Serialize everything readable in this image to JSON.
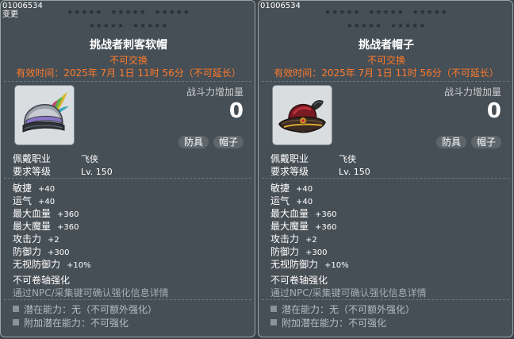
{
  "panels": [
    {
      "code": "01006534",
      "change_label": "变更",
      "stars_row1": [
        "★★★★★",
        "★★★★★",
        "★★★★★"
      ],
      "stars_row2": [
        "★★★★★",
        "★★★★★"
      ],
      "title": "挑战者刺客软帽",
      "untradeable": "不可交换",
      "expiry": "有效时间：2025年 7月 1日 11时 56分（不可延长）",
      "icon": "assassin-hat-icon",
      "power_label": "战斗力增加量",
      "power_value": "0",
      "tags": [
        "防具",
        "帽子"
      ],
      "job_label": "佩戴职业",
      "job_value": "飞侠",
      "level_label": "要求等级",
      "level_value": "Lv. 150",
      "stats": [
        {
          "name": "敏捷",
          "value": "+40"
        },
        {
          "name": "运气",
          "value": "+40"
        },
        {
          "name": "最大血量",
          "value": "+360"
        },
        {
          "name": "最大魔量",
          "value": "+360"
        },
        {
          "name": "攻击力",
          "value": "+2"
        },
        {
          "name": "防御力",
          "value": "+300"
        },
        {
          "name": "无视防御力",
          "value": "+10%"
        }
      ],
      "no_scroll": "不可卷轴强化",
      "npc_note": "通过NPC/采集键可确认强化信息详情",
      "potential": "潜在能力：无（不可额外强化）",
      "bonus_potential": "附加潜在能力：不可强化"
    },
    {
      "code": "01006534",
      "change_label": "",
      "stars_row1": [
        "★★★★★",
        "★★★★★",
        "★★★★★"
      ],
      "stars_row2": [
        "★★★★★",
        "★★★★★"
      ],
      "title": "挑战者帽子",
      "untradeable": "不可交换",
      "expiry": "有效时间：2025年 7月 1日 11时 56分（不可延长）",
      "icon": "pirate-hat-icon",
      "power_label": "战斗力增加量",
      "power_value": "0",
      "tags": [
        "防具",
        "帽子"
      ],
      "job_label": "佩戴职业",
      "job_value": "飞侠",
      "level_label": "要求等级",
      "level_value": "Lv. 150",
      "stats": [
        {
          "name": "敏捷",
          "value": "+40"
        },
        {
          "name": "运气",
          "value": "+40"
        },
        {
          "name": "最大血量",
          "value": "+360"
        },
        {
          "name": "最大魔量",
          "value": "+360"
        },
        {
          "name": "攻击力",
          "value": "+2"
        },
        {
          "name": "防御力",
          "value": "+300"
        },
        {
          "name": "无视防御力",
          "value": "+10%"
        }
      ],
      "no_scroll": "不可卷轴强化",
      "npc_note": "通过NPC/采集键可确认强化信息详情",
      "potential": "潜在能力：无（不可额外强化）",
      "bonus_potential": "附加潜在能力：不可强化"
    }
  ],
  "colors": {
    "panel_bg": "#474f56",
    "accent_orange": "#ff7a2a",
    "muted_text": "#a6adb2"
  }
}
